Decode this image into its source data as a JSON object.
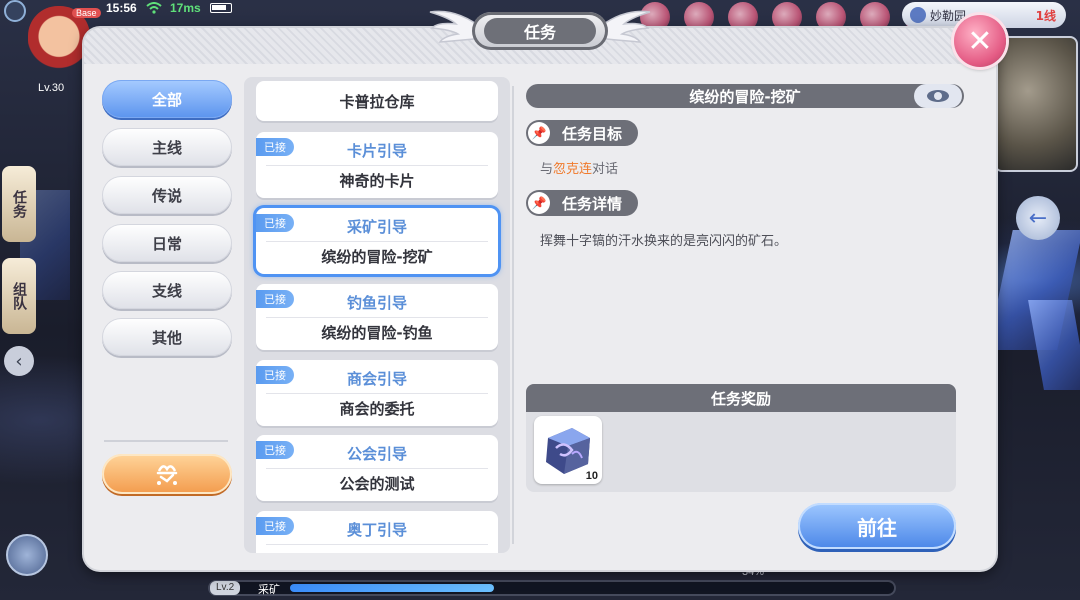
{
  "hud": {
    "time": "15:56",
    "ping": "17ms",
    "base_tag": "Base",
    "player_level": "Lv.30",
    "map_name": "妙勒园",
    "map_line": "1线",
    "side_tab_quest": "任务",
    "side_tab_team": "组队",
    "exp_level": "Lv.2",
    "exp_label": "采矿",
    "exp_percent_text": "34%",
    "exp_progress": 0.34
  },
  "panel": {
    "title": "任务",
    "close_label": "✕"
  },
  "categories": [
    {
      "label": "全部",
      "active": true
    },
    {
      "label": "主线",
      "active": false
    },
    {
      "label": "传说",
      "active": false
    },
    {
      "label": "日常",
      "active": false
    },
    {
      "label": "支线",
      "active": false
    },
    {
      "label": "其他",
      "active": false
    }
  ],
  "quests": [
    {
      "type": "",
      "name": "卡普拉仓库",
      "accepted": false,
      "selected": false,
      "partial": true
    },
    {
      "type": "卡片引导",
      "name": "神奇的卡片",
      "accepted": true,
      "selected": false
    },
    {
      "type": "采矿引导",
      "name": "缤纷的冒险-挖矿",
      "accepted": true,
      "selected": true
    },
    {
      "type": "钓鱼引导",
      "name": "缤纷的冒险-钓鱼",
      "accepted": true,
      "selected": false
    },
    {
      "type": "商会引导",
      "name": "商会的委托",
      "accepted": true,
      "selected": false
    },
    {
      "type": "公会引导",
      "name": "公会的测试",
      "accepted": true,
      "selected": false
    },
    {
      "type": "奥丁引导",
      "name": "",
      "accepted": true,
      "selected": false
    }
  ],
  "accepted_label": "已接",
  "detail": {
    "title": "缤纷的冒险-挖矿",
    "objective_label": "任务目标",
    "objective_prefix": "与",
    "objective_npc": "忽克连",
    "objective_suffix": "对话",
    "details_label": "任务详情",
    "details_text": "挥舞十字镐的汗水换来的是亮闪闪的矿石。",
    "reward_label": "任务奖励",
    "rewards": [
      {
        "icon": "ore-crystal-icon",
        "count": "10"
      }
    ],
    "go_button": "前往"
  },
  "colors": {
    "accent_blue": "#5b94ee",
    "npc_orange": "#f07a2c",
    "close_pink": "#e45b84"
  }
}
